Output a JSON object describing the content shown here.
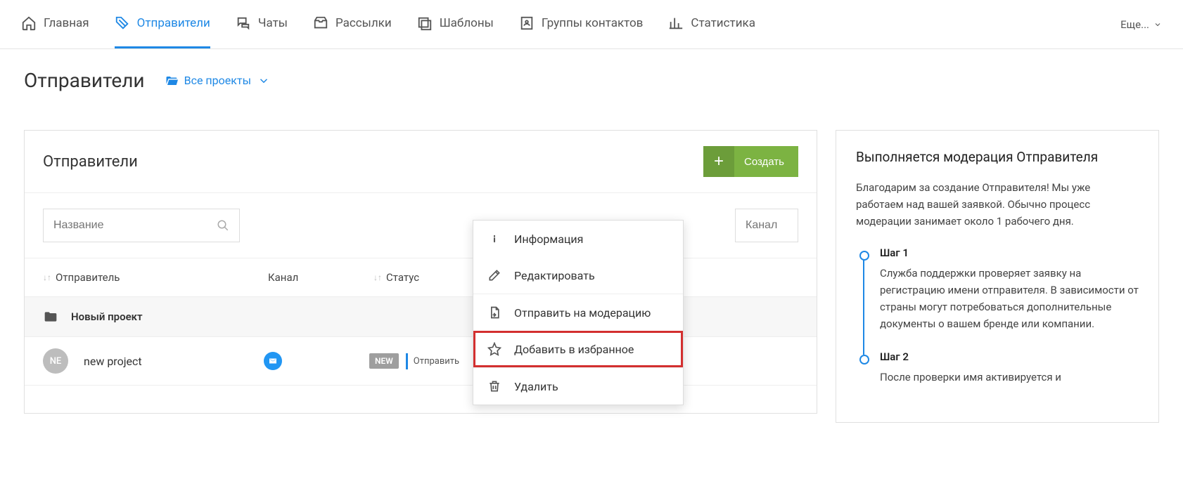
{
  "nav": {
    "items": [
      {
        "label": "Главная"
      },
      {
        "label": "Отправители"
      },
      {
        "label": "Чаты"
      },
      {
        "label": "Рассылки"
      },
      {
        "label": "Шаблоны"
      },
      {
        "label": "Группы контактов"
      },
      {
        "label": "Статистика"
      }
    ],
    "more": "Еще..."
  },
  "page": {
    "title": "Отправители",
    "project_selector": "Все проекты"
  },
  "panel": {
    "title": "Отправители",
    "create_btn": "Создать",
    "filter_name_placeholder": "Название",
    "filter_channel_placeholder": "Канал",
    "columns": {
      "sender": "Отправитель",
      "channel": "Канал",
      "status": "Статус"
    },
    "group": "Новый проект",
    "row": {
      "avatar": "NE",
      "name": "new project",
      "badge": "NEW",
      "action": "Отправить"
    }
  },
  "context_menu": {
    "info": "Информация",
    "edit": "Редактировать",
    "moderate": "Отправить на модерацию",
    "favorite": "Добавить в избранное",
    "delete": "Удалить"
  },
  "sidebar": {
    "title": "Выполняется модерация Отправителя",
    "intro": "Благодарим за создание Отправителя! Мы уже работаем над вашей заявкой. Обычно процесс модерации занимает около 1 рабочего дня.",
    "steps": [
      {
        "title": "Шаг 1",
        "text": "Служба поддержки проверяет заявку на регистрацию имени отправителя. В зависимости от страны могут потребоваться дополнительные документы о вашем бренде или компании."
      },
      {
        "title": "Шаг 2",
        "text": "После проверки имя активируется и"
      }
    ]
  }
}
